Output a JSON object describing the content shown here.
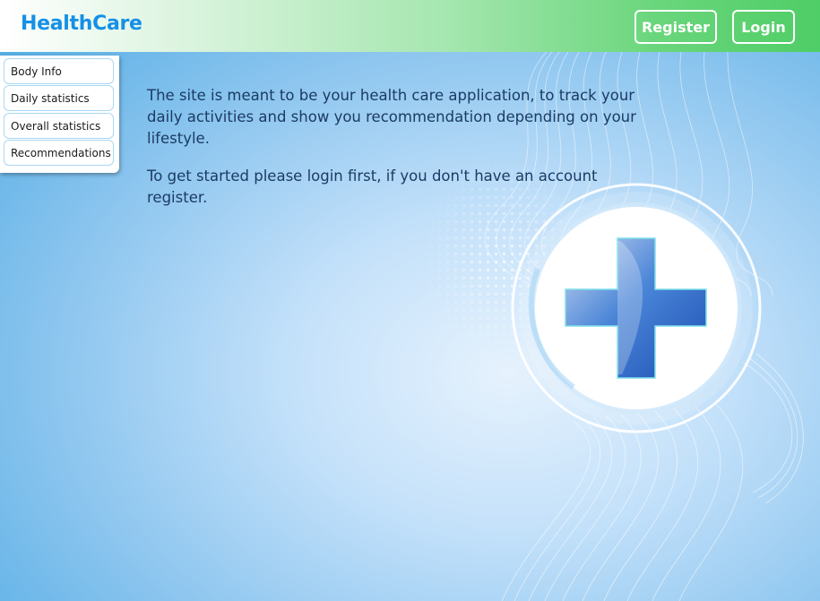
{
  "header": {
    "brand": "HealthCare",
    "register_label": "Register",
    "login_label": "Login"
  },
  "sidebar": {
    "items": [
      {
        "label": "Body Info"
      },
      {
        "label": "Daily statistics"
      },
      {
        "label": "Overall statistics"
      },
      {
        "label": "Recommendations"
      }
    ]
  },
  "main": {
    "paragraphs": [
      "The site is meant to be your health care application, to track your daily activities and show you recommendation depending on your lifestyle.",
      "To get started please login first, if you don't have an account register."
    ]
  },
  "colors": {
    "brand_text": "#1590e6",
    "header_green": "#4fcd66",
    "background_blue": "#4aa9e4",
    "body_text": "#1b3b63"
  },
  "icons": {
    "background": "medical-cross-icon"
  }
}
